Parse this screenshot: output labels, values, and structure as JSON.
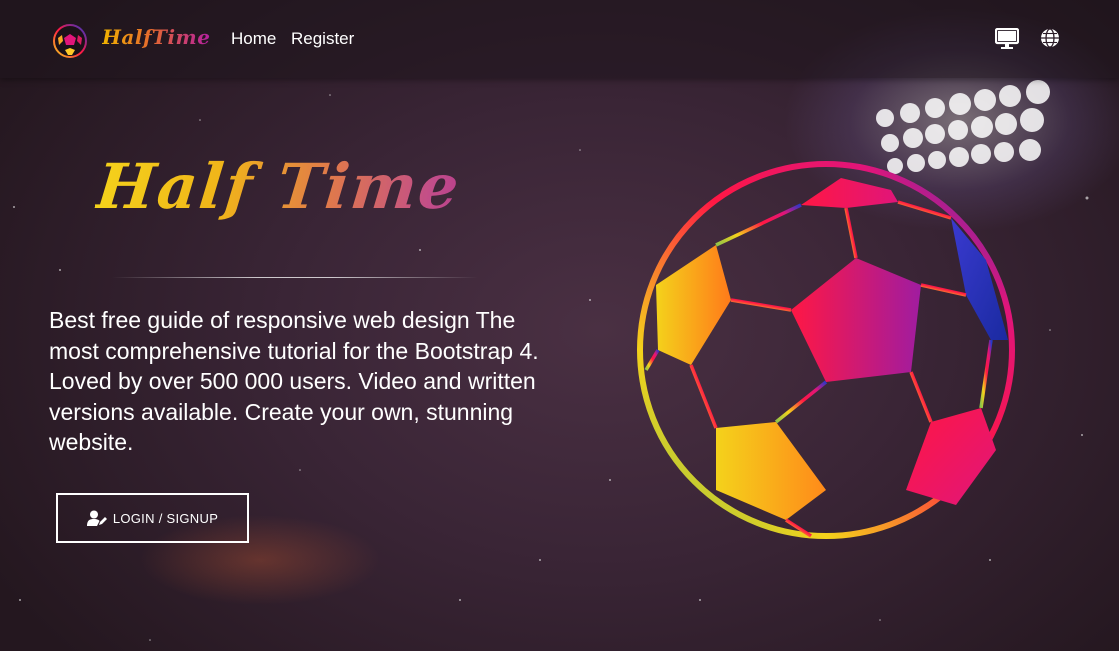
{
  "header": {
    "brand": "HalfTime",
    "nav": {
      "home": "Home",
      "register": "Register"
    },
    "icons": [
      "monitor-icon",
      "globe-icon"
    ]
  },
  "hero": {
    "title": "Half Time",
    "description": "Best free guide of responsive web design The most comprehensive tutorial for the Bootstrap 4. Loved by over 500 000 users. Video and written versions available. Create your own, stunning website.",
    "button_label": "LOGIN / SIGNUP",
    "button_icon": "user-edit-icon"
  },
  "colors": {
    "accent_yellow": "#f4d21b",
    "accent_magenta": "#b51fa0",
    "ball_red": "#ff1744",
    "ball_blue": "#2638c9",
    "background": "#3a2536"
  }
}
